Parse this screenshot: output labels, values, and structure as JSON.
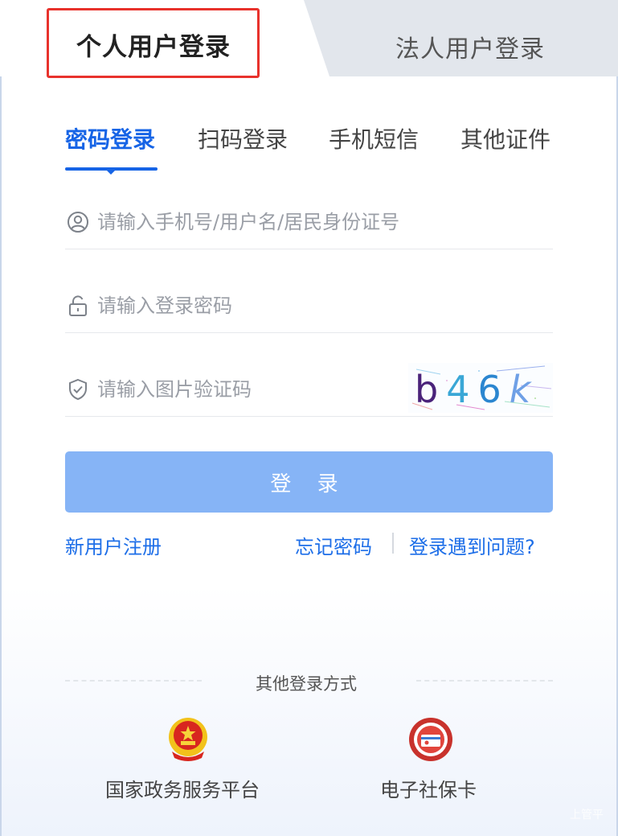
{
  "user_tabs": {
    "personal": "个人用户登录",
    "legal": "法人用户登录"
  },
  "method_tabs": [
    {
      "label": "密码登录",
      "active": true
    },
    {
      "label": "扫码登录",
      "active": false
    },
    {
      "label": "手机短信",
      "active": false
    },
    {
      "label": "其他证件",
      "active": false
    }
  ],
  "fields": {
    "account": {
      "placeholder": "请输入手机号/用户名/居民身份证号",
      "icon": "user-icon"
    },
    "password": {
      "placeholder": "请输入登录密码",
      "icon": "lock-icon"
    },
    "captcha": {
      "placeholder": "请输入图片验证码",
      "icon": "shield-icon",
      "code": "b46k"
    }
  },
  "buttons": {
    "login": "登 录"
  },
  "links": {
    "register": "新用户注册",
    "forgot": "忘记密码",
    "problem": "登录遇到问题?"
  },
  "other_login": {
    "title": "其他登录方式",
    "options": [
      {
        "label": "国家政务服务平台",
        "icon": "national-emblem-icon"
      },
      {
        "label": "电子社保卡",
        "icon": "social-security-card-icon"
      }
    ]
  },
  "watermark": "上管平",
  "colors": {
    "accent": "#1664e6",
    "button": "#86b4f6",
    "highlight": "#e8322c"
  }
}
